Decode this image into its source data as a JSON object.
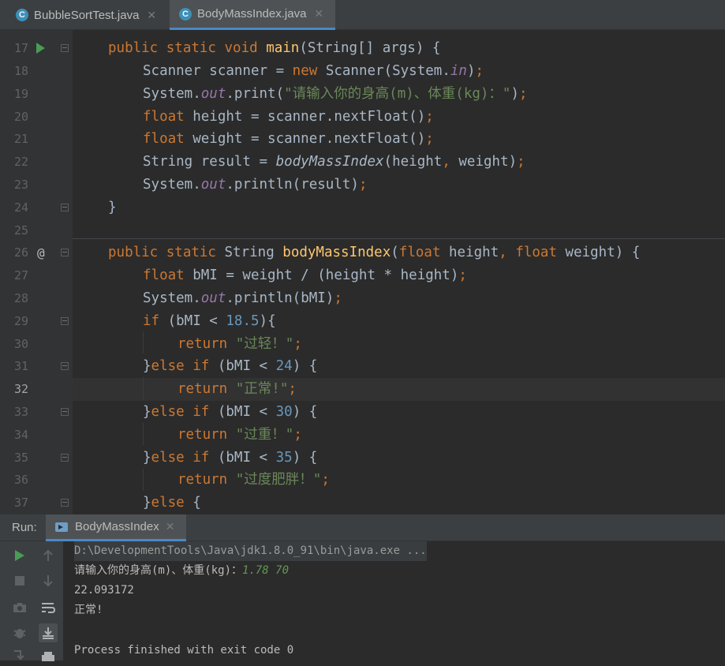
{
  "tabs": [
    {
      "label": "BubbleSortTest.java",
      "active": false
    },
    {
      "label": "BodyMassIndex.java",
      "active": true
    }
  ],
  "editor": {
    "line_numbers": [
      "17",
      "18",
      "19",
      "20",
      "21",
      "22",
      "23",
      "24",
      "25",
      "26",
      "27",
      "28",
      "29",
      "30",
      "31",
      "32",
      "33",
      "34",
      "35",
      "36",
      "37"
    ],
    "current_line": "32",
    "gutter_markers": {
      "run": "17",
      "override": "26"
    },
    "override_symbol": "@",
    "code": {
      "l17": {
        "kw1": "public static void ",
        "fn": "main",
        "rest": "(String[] args) {"
      },
      "l18": {
        "a": "Scanner scanner = ",
        "kw": "new ",
        "b": "Scanner(System.",
        "it": "in",
        "c": ")",
        "semi": ";"
      },
      "l19": {
        "a": "System.",
        "it": "out",
        "b": ".print(",
        "st": "\"请输入你的身高(m)、体重(kg)：\"",
        "c": ")",
        "semi": ";"
      },
      "l20": {
        "kw": "float ",
        "a": "height = scanner.nextFloat()",
        "semi": ";"
      },
      "l21": {
        "kw": "float ",
        "a": "weight = scanner.nextFloat()",
        "semi": ";"
      },
      "l22": {
        "a": "String result = ",
        "mi": "bodyMassIndex",
        "b": "(height",
        "comma": ", ",
        "c": "weight)",
        "semi": ";"
      },
      "l23": {
        "a": "System.",
        "it": "out",
        "b": ".println(result)",
        "semi": ";"
      },
      "l24": {
        "a": "}"
      },
      "l26": {
        "kw1": "public static ",
        "a": "String ",
        "fn": "bodyMassIndex",
        "b": "(",
        "kw2": "float ",
        "c": "height",
        "comma": ", ",
        "kw3": "float ",
        "d": "weight) {"
      },
      "l27": {
        "kw": "float ",
        "a": "bMI = weight / (height * height)",
        "semi": ";"
      },
      "l28": {
        "a": "System.",
        "it": "out",
        "b": ".println(bMI)",
        "semi": ";"
      },
      "l29": {
        "kw": "if ",
        "a": "(bMI < ",
        "nm": "18.5",
        "b": "){"
      },
      "l30": {
        "kw": "return ",
        "st": "\"过轻！\"",
        "semi": ";"
      },
      "l31": {
        "a": "}",
        "kw": "else if ",
        "b": "(bMI < ",
        "nm": "24",
        "c": ") {"
      },
      "l32": {
        "kw": "return ",
        "st": "\"正常!\"",
        "semi": ";"
      },
      "l33": {
        "a": "}",
        "kw": "else if ",
        "b": "(bMI < ",
        "nm": "30",
        "c": ") {"
      },
      "l34": {
        "kw": "return ",
        "st": "\"过重！\"",
        "semi": ";"
      },
      "l35": {
        "a": "}",
        "kw": "else if ",
        "b": "(bMI < ",
        "nm": "35",
        "c": ") {"
      },
      "l36": {
        "kw": "return ",
        "st": "\"过度肥胖！\"",
        "semi": ";"
      },
      "l37": {
        "a": "}",
        "kw": "else ",
        "b": "{"
      }
    }
  },
  "run": {
    "label": "Run:",
    "tab_label": "BodyMassIndex",
    "output": {
      "command": "D:\\DevelopmentTools\\Java\\jdk1.8.0_91\\bin\\java.exe ...",
      "prompt": "请输入你的身高(m)、体重(kg)：",
      "user_input": "1.78 70",
      "bmi_value": "22.093172",
      "result": "正常!",
      "exit_message": "Process finished with exit code 0"
    }
  },
  "icons": [
    "java-class-icon",
    "close-icon",
    "run-icon",
    "fold-icon",
    "override-icon",
    "rerun-icon",
    "stop-icon",
    "scroll-up-icon",
    "scroll-down-icon",
    "camera-icon",
    "soft-wrap-icon",
    "debug-icon",
    "scroll-to-end-icon",
    "print-icon"
  ],
  "colors": {
    "keyword": "#cc7832",
    "string": "#6a8759",
    "number": "#6897bb",
    "method": "#ffc66d",
    "field": "#9876aa",
    "accent": "#4a88c7",
    "run": "#499c54"
  }
}
